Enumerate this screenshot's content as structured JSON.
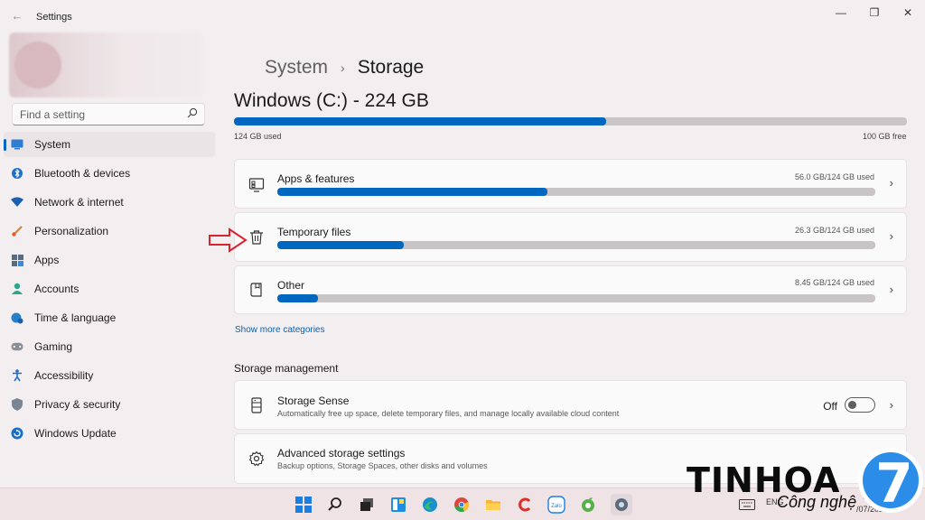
{
  "window": {
    "title": "Settings",
    "back_glyph": "←",
    "minimize_glyph": "—",
    "maximize_glyph": "❐",
    "close_glyph": "✕"
  },
  "search": {
    "placeholder": "Find a setting"
  },
  "sidebar": {
    "items": [
      {
        "label": "System",
        "icon": "monitor-icon",
        "active": true
      },
      {
        "label": "Bluetooth & devices",
        "icon": "bluetooth-icon"
      },
      {
        "label": "Network & internet",
        "icon": "wifi-icon"
      },
      {
        "label": "Personalization",
        "icon": "brush-icon"
      },
      {
        "label": "Apps",
        "icon": "apps-icon"
      },
      {
        "label": "Accounts",
        "icon": "person-icon"
      },
      {
        "label": "Time & language",
        "icon": "globe-clock-icon"
      },
      {
        "label": "Gaming",
        "icon": "gamepad-icon"
      },
      {
        "label": "Accessibility",
        "icon": "accessibility-icon"
      },
      {
        "label": "Privacy & security",
        "icon": "shield-icon"
      },
      {
        "label": "Windows Update",
        "icon": "update-icon"
      }
    ]
  },
  "breadcrumb": {
    "parent": "System",
    "separator": "›",
    "current": "Storage"
  },
  "drive": {
    "title": "Windows (C:) - 224 GB",
    "used_label": "124 GB used",
    "free_label": "100 GB free",
    "used_fraction": 0.553
  },
  "categories": [
    {
      "label": "Apps & features",
      "usage": "56.0 GB/124 GB used",
      "fraction": 0.452,
      "icon": "apps-features-icon"
    },
    {
      "label": "Temporary files",
      "usage": "26.3 GB/124 GB used",
      "fraction": 0.212,
      "icon": "trash-icon"
    },
    {
      "label": "Other",
      "usage": "8.45 GB/124 GB used",
      "fraction": 0.068,
      "icon": "other-icon"
    }
  ],
  "show_more": "Show more categories",
  "storage_management": {
    "title": "Storage management",
    "storage_sense": {
      "label": "Storage Sense",
      "description": "Automatically free up space, delete temporary files, and manage locally available cloud content",
      "toggle_label": "Off",
      "toggle_on": false
    },
    "advanced": {
      "label": "Advanced storage settings",
      "description": "Backup options, Storage Spaces, other disks and volumes"
    }
  },
  "chevron": "›",
  "taskbar": {
    "apps": [
      "start-icon",
      "search-icon",
      "task-view-icon",
      "widgets-icon",
      "edge-icon",
      "chrome-icon",
      "file-explorer-icon",
      "ccleaner-icon",
      "zalo-icon",
      "coccoc-icon",
      "settings-icon"
    ],
    "zalo_text": "Zalo",
    "lang": "ENG",
    "time_partial": "9",
    "date_partial": "/07/2021"
  },
  "watermark": {
    "brand": "TINHOA",
    "sub": "Công nghệ",
    "badge": "7"
  },
  "colors": {
    "accent": "#0067c0",
    "track": "#c9c4c6",
    "annotation": "#d9232d"
  }
}
